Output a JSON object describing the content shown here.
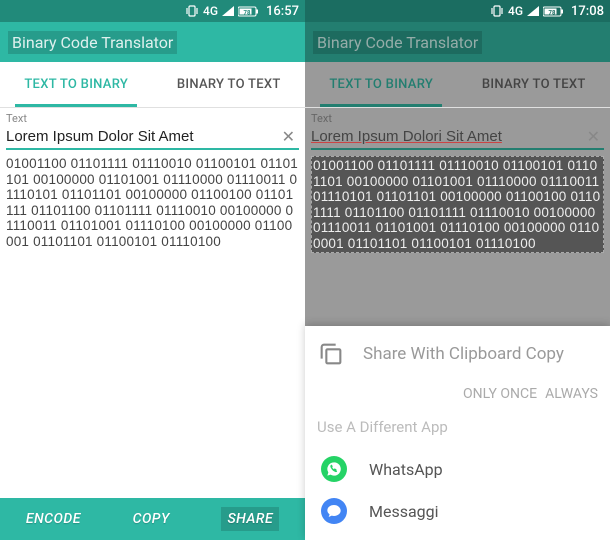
{
  "left": {
    "status": {
      "sig": "4G",
      "batt": "78",
      "time": "16:57"
    },
    "app_title": "Binary Code Translator",
    "tabs": {
      "tab1": "TEXT TO BINARY",
      "tab2": "BINARY TO TEXT"
    },
    "label": "Text",
    "input_value": "Lorem Ipsum Dolor Sit Amet",
    "binary": "01001100 01101111 01110010 01100101 01101101 00100000 01101001 01110000 01110011 01110101 01101101 00100000 01100100 01101111 01101100 01101111 01110010 00100000 01110011 01101001 01110100 00100000 01100001 01101101 01100101 01110100",
    "buttons": {
      "encode": "ENCODE",
      "copy": "COPY",
      "share": "SHARE"
    }
  },
  "right": {
    "status": {
      "sig": "4G",
      "batt": "78",
      "time": "17:08"
    },
    "app_title": "Binary Code Translator",
    "tabs": {
      "tab1": "TEXT TO BINARY",
      "tab2": "BINARY TO TEXT"
    },
    "label": "Text",
    "input_value": "Lorem Ipsum Dolori Sit Amet",
    "binary": "01001100 01101111 01110010 01100101 01101101 00100000 01101001 01110000 01110011 01110101 01101101 00100000 01100100 01101111 01101100 01101111 01110010 00100000 01110011 01101001 01110100 00100000 01100001 01101101 01100101 01110100",
    "share": {
      "title": "Share With Clipboard Copy",
      "once": "ONLY ONCE",
      "always": "ALWAYS",
      "diff": "Use A Different App",
      "apps": {
        "whatsapp": "WhatsApp",
        "messaggi": "Messaggi"
      }
    }
  }
}
